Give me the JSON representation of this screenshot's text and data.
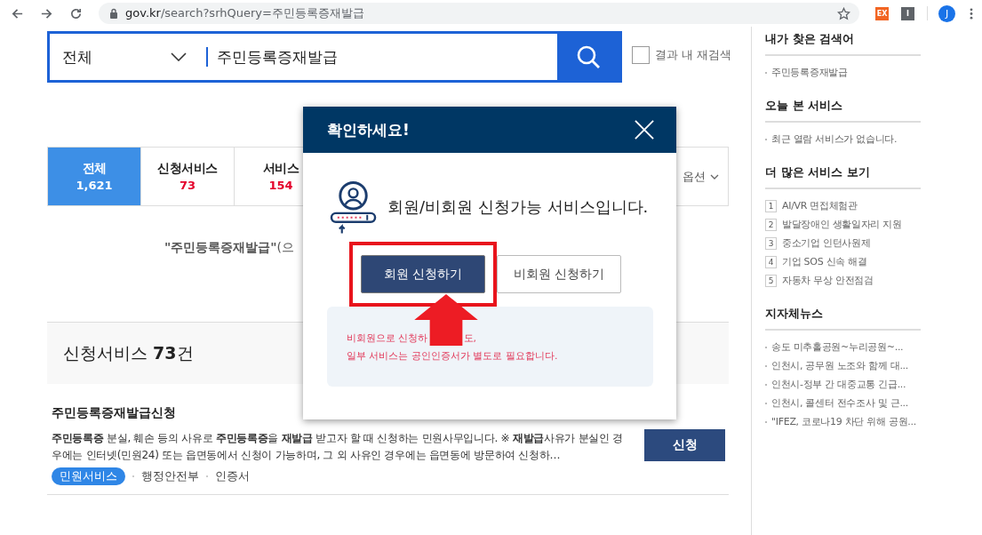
{
  "browser": {
    "url_host": "gov.kr",
    "url_path": "/search?srhQuery=주민등록증재발급",
    "extensions": [
      {
        "label": "EX",
        "color": "#f26522"
      },
      {
        "label": "I",
        "color": "#5f6368"
      }
    ],
    "avatar": "J"
  },
  "search": {
    "scope": "전체",
    "query": "주민등록증재발급",
    "refine": {
      "label": "결과 내 재검색",
      "checked": false
    }
  },
  "tabs": [
    {
      "label": "전체",
      "count": "1,621",
      "selected": true
    },
    {
      "label": "신청서비스",
      "count": "73",
      "selected": false
    },
    {
      "label": "서비스",
      "count": "154",
      "selected": false
    }
  ],
  "options_label": "옵션",
  "result_summary": "**\"주민등록증재발급\"**(으",
  "section_title": "신청서비스 **73**건",
  "result": {
    "title": "**주민등록증재발급**신청",
    "description": "**주민등록증** 분실, 훼손 등의 사유로 **주민등록증**을 **재발급** 받고자 할 때 신청하는 민원사무입니다. ※ **재발급**사유가 분실인 경우에는 인터넷(민원24) 또는 읍면동에서 신청이 가능하며, 그 외 사유인 경우에는 읍면동에 방문하여 신청하…",
    "tags": [
      {
        "label": "민원서비스",
        "kind": "pill"
      },
      {
        "label": "행정안전부",
        "kind": "text"
      },
      {
        "label": "인증서",
        "kind": "text"
      }
    ],
    "action": "신청"
  },
  "modal": {
    "title": "확인하세요!",
    "message": "회원/비회원 신청가능 서비스입니다.",
    "buttons": [
      {
        "label": "회원 신청하기",
        "kind": "primary",
        "highlighted": true
      },
      {
        "label": "비회원 신청하기",
        "kind": "secondary",
        "highlighted": false
      }
    ],
    "note_line_1_parts": [
      "비회원으로 신청하",
      "도,"
    ],
    "note_line_2": "일부 서비스는 공인인증서가 별도로 필요합니다."
  },
  "sidebar": [
    {
      "title": "내가 찾은 검색어",
      "kind": "bullet",
      "items": [
        {
          "label": "주민등록증재발급"
        }
      ]
    },
    {
      "title": "오늘 본 서비스",
      "kind": "bullet",
      "items": [
        {
          "label": "최근 열람 서비스가 없습니다."
        }
      ]
    },
    {
      "title": "더 많은 서비스 보기",
      "kind": "numbered",
      "items": [
        {
          "rank": "1",
          "label": "AI/VR 면접체험관"
        },
        {
          "rank": "2",
          "label": "발달장애인 생활일자리 지원"
        },
        {
          "rank": "3",
          "label": "중소기업 인턴사원제"
        },
        {
          "rank": "4",
          "label": "기업 SOS 신속 해결"
        },
        {
          "rank": "5",
          "label": "자동차 무상 안전점검"
        }
      ]
    },
    {
      "title": "지자체뉴스",
      "kind": "bullet",
      "items": [
        {
          "label": "송도 미추홀공원~누리공원~..."
        },
        {
          "label": "인천시, 공무원 노조와 함께 대..."
        },
        {
          "label": "인천시-정부 간 대중교통 긴급..."
        },
        {
          "label": "인천시, 콜센터 전수조사 및 근..."
        },
        {
          "label": "\"IFEZ, 코로나19 차단 위해 공원..."
        }
      ]
    }
  ]
}
